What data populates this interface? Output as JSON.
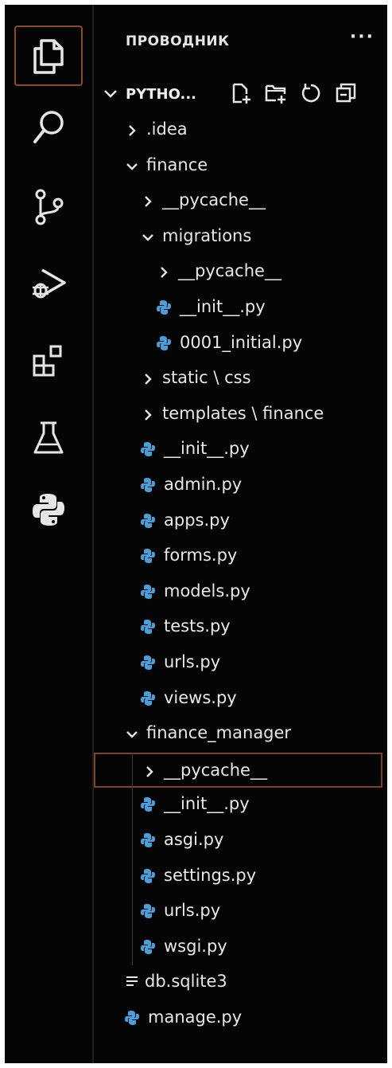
{
  "explorer": {
    "title": "ПРОВОДНИК",
    "more_label": "···",
    "root_label": "PYTHO..."
  },
  "activity_bar": {
    "items": [
      {
        "name": "explorer",
        "icon": "files-icon",
        "active": true
      },
      {
        "name": "search",
        "icon": "search-icon",
        "active": false
      },
      {
        "name": "source-control",
        "icon": "source-control-icon",
        "active": false
      },
      {
        "name": "run-and-debug",
        "icon": "run-debug-icon",
        "active": false
      },
      {
        "name": "extensions",
        "icon": "extensions-icon",
        "active": false
      },
      {
        "name": "testing",
        "icon": "flask-icon",
        "active": false
      },
      {
        "name": "python",
        "icon": "python-icon",
        "active": false
      }
    ]
  },
  "root_actions": [
    {
      "name": "new-file",
      "icon": "new-file-icon"
    },
    {
      "name": "new-folder",
      "icon": "new-folder-icon"
    },
    {
      "name": "refresh",
      "icon": "refresh-icon"
    },
    {
      "name": "collapse-all",
      "icon": "collapse-all-icon"
    }
  ],
  "tree": [
    {
      "label": ".idea",
      "type": "folder",
      "expanded": false,
      "depth": 1
    },
    {
      "label": "finance",
      "type": "folder",
      "expanded": true,
      "depth": 1
    },
    {
      "label": "__pycache__",
      "type": "folder",
      "expanded": false,
      "depth": 2
    },
    {
      "label": "migrations",
      "type": "folder",
      "expanded": true,
      "depth": 2
    },
    {
      "label": "__pycache__",
      "type": "folder",
      "expanded": false,
      "depth": 3
    },
    {
      "label": "__init__.py",
      "type": "python",
      "depth": 3
    },
    {
      "label": "0001_initial.py",
      "type": "python",
      "depth": 3
    },
    {
      "label": "static \\ css",
      "type": "folder",
      "expanded": false,
      "depth": 2
    },
    {
      "label": "templates \\ finance",
      "type": "folder",
      "expanded": false,
      "depth": 2
    },
    {
      "label": "__init__.py",
      "type": "python",
      "depth": 2
    },
    {
      "label": "admin.py",
      "type": "python",
      "depth": 2
    },
    {
      "label": "apps.py",
      "type": "python",
      "depth": 2
    },
    {
      "label": "forms.py",
      "type": "python",
      "depth": 2
    },
    {
      "label": "models.py",
      "type": "python",
      "depth": 2
    },
    {
      "label": "tests.py",
      "type": "python",
      "depth": 2
    },
    {
      "label": "urls.py",
      "type": "python",
      "depth": 2
    },
    {
      "label": "views.py",
      "type": "python",
      "depth": 2
    },
    {
      "label": "finance_manager",
      "type": "folder",
      "expanded": true,
      "depth": 1
    },
    {
      "label": "__pycache__",
      "type": "folder",
      "expanded": false,
      "depth": 2,
      "selected": true
    },
    {
      "label": "__init__.py",
      "type": "python",
      "depth": 2
    },
    {
      "label": "asgi.py",
      "type": "python",
      "depth": 2
    },
    {
      "label": "settings.py",
      "type": "python",
      "depth": 2
    },
    {
      "label": "urls.py",
      "type": "python",
      "depth": 2
    },
    {
      "label": "wsgi.py",
      "type": "python",
      "depth": 2
    },
    {
      "label": "db.sqlite3",
      "type": "database",
      "depth": 1
    },
    {
      "label": "manage.py",
      "type": "python",
      "depth": 1
    }
  ],
  "colors": {
    "background": "#050505",
    "text": "#e8e8e8",
    "icon": "#e6e6e6",
    "python_icon": "#4a9fd8",
    "active_border": "#8a4a2a",
    "selected_border": "#7a4420"
  }
}
